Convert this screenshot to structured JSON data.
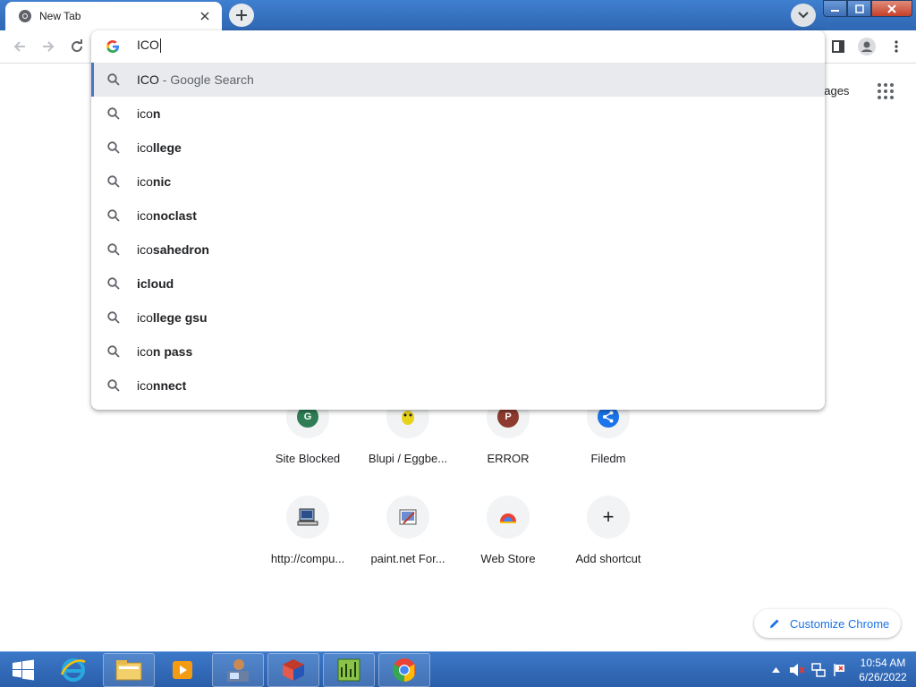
{
  "tab": {
    "title": "New Tab",
    "close_icon": "close-icon"
  },
  "toolbar": {
    "back_icon": "arrow-left-icon",
    "forward_icon": "arrow-right-icon",
    "reload_icon": "reload-icon"
  },
  "omnibox": {
    "value": "ICO",
    "suggestions": [
      {
        "prefix": "ICO",
        "suffix": "",
        "dim": " - Google Search"
      },
      {
        "prefix": "ico",
        "suffix": "n",
        "dim": ""
      },
      {
        "prefix": "ico",
        "suffix": "llege",
        "dim": ""
      },
      {
        "prefix": "ico",
        "suffix": "nic",
        "dim": ""
      },
      {
        "prefix": "ico",
        "suffix": "noclast",
        "dim": ""
      },
      {
        "prefix": "ico",
        "suffix": "sahedron",
        "dim": ""
      },
      {
        "prefix": "",
        "suffix": "icloud",
        "dim": ""
      },
      {
        "prefix": "ico",
        "suffix": "llege gsu",
        "dim": ""
      },
      {
        "prefix": "ico",
        "suffix": "n pass",
        "dim": ""
      },
      {
        "prefix": "ico",
        "suffix": "nnect",
        "dim": ""
      }
    ]
  },
  "page": {
    "images_label": "nages",
    "shortcuts": [
      {
        "label": "Site Blocked",
        "letter": "G",
        "color": "#2e7d55"
      },
      {
        "label": "Blupi / Eggbe...",
        "letter": "",
        "color": ""
      },
      {
        "label": "ERROR",
        "letter": "P",
        "color": "#8d3b2e"
      },
      {
        "label": "Filedm",
        "letter": "",
        "color": "#1a73e8"
      },
      {
        "label": "http://compu...",
        "letter": "",
        "color": ""
      },
      {
        "label": "paint.net For...",
        "letter": "",
        "color": ""
      },
      {
        "label": "Web Store",
        "letter": "",
        "color": ""
      },
      {
        "label": "Add shortcut",
        "letter": "+",
        "color": ""
      }
    ],
    "customize_label": "Customize Chrome"
  },
  "taskbar": {
    "time": "10:54 AM",
    "date": "6/26/2022"
  },
  "colors": {
    "accent": "#1a73e8",
    "selected_bar": "#4a78c4",
    "titlebar": "#2f67b3"
  }
}
